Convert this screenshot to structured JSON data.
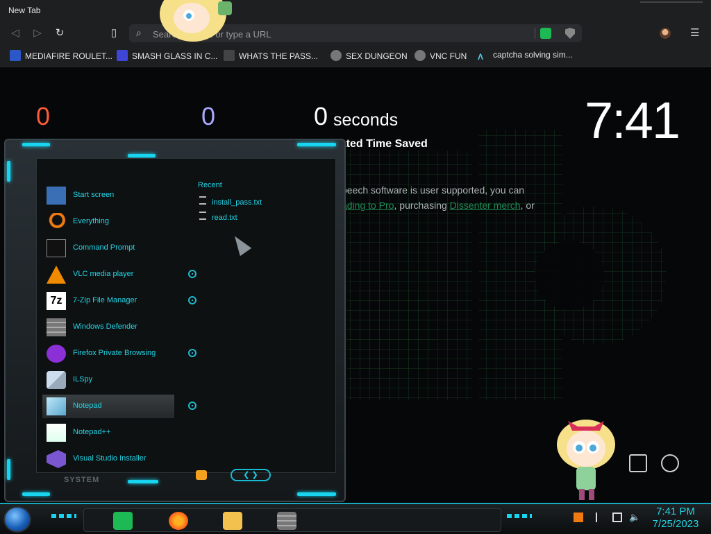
{
  "browser": {
    "tab_title": "New Tab",
    "search_placeholder": "Search Google or type a URL",
    "bookmarks": [
      {
        "label": "MEDIAFIRE ROULET...",
        "color": "#2b57c8"
      },
      {
        "label": "SMASH GLASS IN C...",
        "color": "#3f46d6"
      },
      {
        "label": "WHATS THE PASS...",
        "color": "#444"
      },
      {
        "label": "SEX DUNGEON",
        "color": "#777"
      },
      {
        "label": "VNC FUN",
        "color": "#777"
      },
      {
        "label": "captcha solving sim...",
        "color": "#4fd0e8"
      }
    ]
  },
  "newtab": {
    "stat1": "0",
    "stat1_color": "#ff5a3c",
    "stat2": "0",
    "stat2_color": "#a9a6ff",
    "stat3": "0",
    "seconds_label": "seconds",
    "saved_label": "nated Time Saved",
    "clock": "7:41",
    "support_line1": "peech software is user supported, you can",
    "support_link1": "ading to Pro",
    "support_mid": ", purchasing ",
    "support_link2": "Dissenter merch",
    "support_end": ", or"
  },
  "startmenu": {
    "apps": [
      {
        "label": "Start screen",
        "icon": "start-screen-icon",
        "color": "#3a6fb5",
        "pinned": false
      },
      {
        "label": "Everything",
        "icon": "magnifier-icon",
        "color": "#f07a12",
        "pinned": false
      },
      {
        "label": "Command Prompt",
        "icon": "terminal-icon",
        "color": "#111",
        "pinned": false
      },
      {
        "label": "VLC media player",
        "icon": "vlc-cone-icon",
        "color": "#f08a00",
        "pinned": true
      },
      {
        "label": "7-Zip File Manager",
        "icon": "7zip-icon",
        "color": "#fff",
        "pinned": true
      },
      {
        "label": "Windows Defender",
        "icon": "firewall-icon",
        "color": "#888",
        "pinned": false
      },
      {
        "label": "Firefox Private Browsing",
        "icon": "firefox-private-icon",
        "color": "#8b2fd6",
        "pinned": true
      },
      {
        "label": "ILSpy",
        "icon": "ilspy-icon",
        "color": "#9ab",
        "pinned": false
      },
      {
        "label": "Notepad",
        "icon": "notepad-icon",
        "color": "#7fc6e8",
        "pinned": true
      },
      {
        "label": "Notepad++",
        "icon": "notepadpp-icon",
        "color": "#9bd35a",
        "pinned": false
      },
      {
        "label": "Visual Studio Installer",
        "icon": "vs-installer-icon",
        "color": "#7a57d1",
        "pinned": false
      }
    ],
    "recent_title": "Recent",
    "recent": [
      "install_pass.txt",
      "read.txt"
    ],
    "system_label": "SYSTEM",
    "nav_arrows": "❮ ❯"
  },
  "taskbar": {
    "time": "7:41 PM",
    "date": "7/25/2023",
    "apps": [
      {
        "name": "speechify-app",
        "color": "#1db954"
      },
      {
        "name": "firefox-app",
        "color": "#ff7a1a"
      },
      {
        "name": "file-explorer-app",
        "color": "#f2c14e"
      },
      {
        "name": "windows-defender-app",
        "color": "#888"
      }
    ]
  }
}
